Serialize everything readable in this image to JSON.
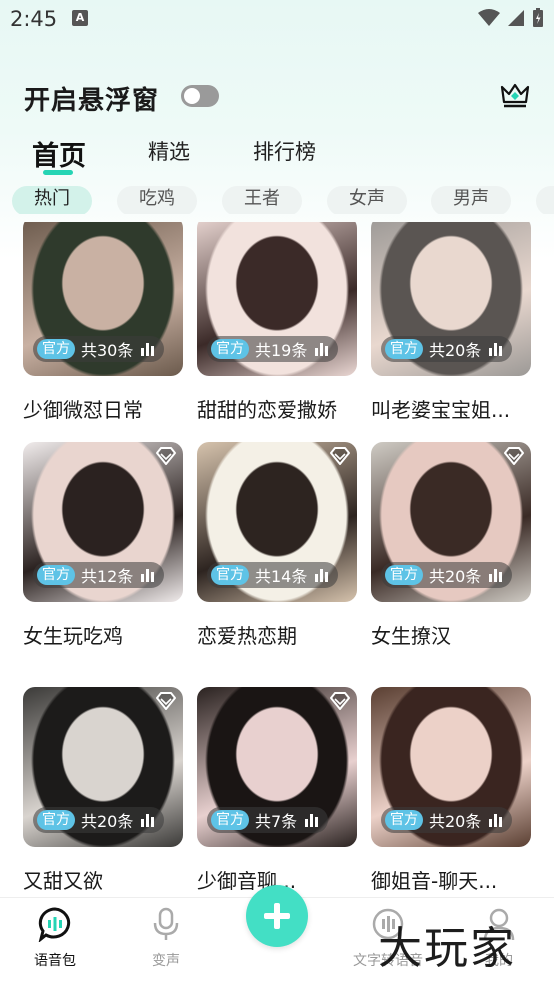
{
  "status_bar": {
    "time": "2:45",
    "notif_letter": "A"
  },
  "header": {
    "title": "开启悬浮窗",
    "toggle_on": false
  },
  "tabs": [
    {
      "label": "首页",
      "active": true
    },
    {
      "label": "精选",
      "active": false
    },
    {
      "label": "排行榜",
      "active": false
    }
  ],
  "chips": [
    "热门",
    "吃鸡",
    "王者",
    "女声",
    "男声"
  ],
  "cards": [
    {
      "title": "少御微怼日常",
      "badge": "官方",
      "count": "共30条",
      "premium": false,
      "colors": [
        "#6b5a4c",
        "#c9b1a3",
        "#2f3a2c"
      ]
    },
    {
      "title": "甜甜的恋爱撒娇",
      "badge": "官方",
      "count": "共19条",
      "premium": false,
      "colors": [
        "#ead7d3",
        "#3b2a28",
        "#f2e2dd"
      ]
    },
    {
      "title": "叫老婆宝宝姐...",
      "badge": "官方",
      "count": "共20条",
      "premium": false,
      "colors": [
        "#9c9996",
        "#e9d8cf",
        "#5a5552"
      ]
    },
    {
      "title": "女生玩吃鸡",
      "badge": "官方",
      "count": "共12条",
      "premium": true,
      "colors": [
        "#f1ecec",
        "#2b2220",
        "#e9d5cf"
      ]
    },
    {
      "title": "恋爱热恋期",
      "badge": "官方",
      "count": "共14条",
      "premium": true,
      "colors": [
        "#d6c3ad",
        "#2d2420",
        "#f4f0e6"
      ]
    },
    {
      "title": "女生撩汉",
      "badge": "官方",
      "count": "共20条",
      "premium": true,
      "colors": [
        "#cfcbc4",
        "#3a2a25",
        "#e6c9c1"
      ]
    },
    {
      "title": "又甜又欲",
      "badge": "官方",
      "count": "共20条",
      "premium": true,
      "colors": [
        "#3b3a38",
        "#d9d4cf",
        "#1c1b1a"
      ]
    },
    {
      "title": "少御音聊...",
      "badge": "官方",
      "count": "共7条",
      "premium": true,
      "colors": [
        "#2a2220",
        "#e8d0cf",
        "#1a1514"
      ]
    },
    {
      "title": "御姐音-聊天...",
      "badge": "官方",
      "count": "共20条",
      "premium": false,
      "colors": [
        "#5a3f32",
        "#ecd1c8",
        "#3a2520"
      ]
    }
  ],
  "bottom_nav": [
    {
      "label": "语音包",
      "icon": "voice-pack-icon",
      "active": true
    },
    {
      "label": "变声",
      "icon": "microphone-icon",
      "active": false
    },
    {
      "label": "文字转语音",
      "icon": "text-to-speech-icon",
      "active": false
    },
    {
      "label": "我的",
      "icon": "profile-icon",
      "active": false
    }
  ],
  "watermark": "大玩家",
  "colors": {
    "accent": "#25d4b4",
    "fab": "#43dfc5",
    "badge": "#5ec3e6"
  }
}
